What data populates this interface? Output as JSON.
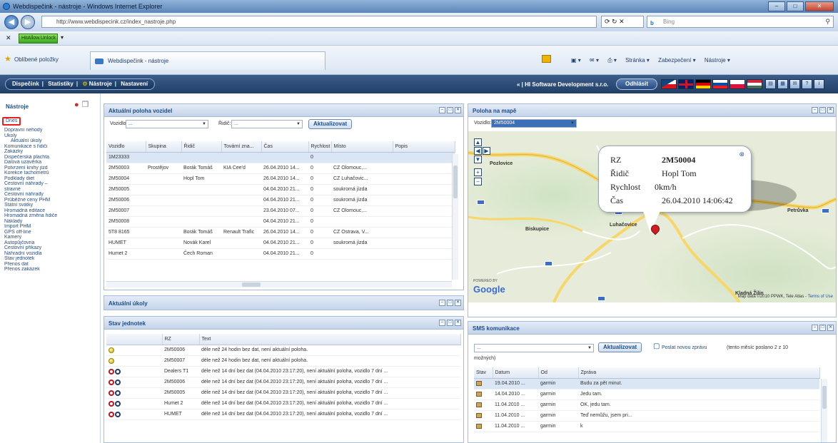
{
  "browser": {
    "title": "Webdispečink - nástroje - Windows Internet Explorer",
    "url": "http://www.webdispecink.cz/index_nastroje.php",
    "search_placeholder": "Bing",
    "toolbar_addon": "HitAllow.Unlock",
    "favorites_label": "Oblíbené položky",
    "tab_title": "Webdispečink - nástroje",
    "cmd": {
      "page": "Stránka ▾",
      "security": "Zabezpečení ▾",
      "tools": "Nástroje ▾"
    }
  },
  "header": {
    "nav": [
      "Dispečink",
      "Statistiky",
      "Nástroje",
      "Nastavení"
    ],
    "company": "« | HI Software Development s.r.o.",
    "logout": "Odhlásit"
  },
  "sidebar": {
    "title": "Nástroje",
    "items": [
      {
        "label": "Dnes",
        "highlight": true
      },
      {
        "label": "Dopravní nehody"
      },
      {
        "label": "Úkoly"
      },
      {
        "label": "Aktuální úkoly",
        "sub": true
      },
      {
        "label": "Komunikace s řidiči"
      },
      {
        "label": "Zakázky"
      },
      {
        "label": "Dispečerská plachta"
      },
      {
        "label": "Dalová uzávěrka"
      },
      {
        "label": "Potvrzení knihy jízd"
      },
      {
        "label": "Korekce tachometrů"
      },
      {
        "label": "Podklady diet"
      },
      {
        "label": "Cestovní náhrady –"
      },
      {
        "label": "stravné"
      },
      {
        "label": "Cestovní náhrady"
      },
      {
        "label": "Průběžné ceny PHM"
      },
      {
        "label": "Státní svátky"
      },
      {
        "label": "Hromadná editace"
      },
      {
        "label": "Hromadná změna řidiče"
      },
      {
        "label": "Náklady"
      },
      {
        "label": "Import PHM"
      },
      {
        "label": "GPS off-line"
      },
      {
        "label": "Kamery"
      },
      {
        "label": "Autopůjčovna"
      },
      {
        "label": "Cestovní příkazy"
      },
      {
        "label": "Náhradní vozidla"
      },
      {
        "label": "Stav jednotek"
      },
      {
        "label": "Přenos dat"
      },
      {
        "label": "Přenos zakázek"
      }
    ]
  },
  "positions_panel": {
    "title": "Aktuální poloha vozidel",
    "vehicle_label": "Vozidlo:",
    "vehicle_value": "...",
    "driver_label": "Řidič:",
    "driver_value": "...",
    "refresh": "Aktualizovat",
    "columns": [
      "Vozidlo",
      "Skupina",
      "Řidič",
      "Tovární zna...",
      "Čas",
      "Rychlost",
      "Místo",
      "Popis"
    ],
    "rows": [
      [
        "1M23333",
        "",
        "",
        "",
        "",
        "0",
        "",
        ""
      ],
      [
        "2M50003",
        "Prostějov",
        "Borák Tomáš",
        "KIA Cee'd",
        "26.04.2010 14...",
        "0",
        "CZ Olomouc,...",
        ""
      ],
      [
        "2M50004",
        "",
        "Hopl Tom",
        "",
        "26.04.2010 14...",
        "0",
        "CZ Luhačovic...",
        ""
      ],
      [
        "2M50005",
        "",
        "",
        "",
        "04.04.2010 21...",
        "0",
        "soukromá jízda",
        ""
      ],
      [
        "2M50006",
        "",
        "",
        "",
        "04.04.2010 21...",
        "0",
        "soukromá jízda",
        ""
      ],
      [
        "2M50007",
        "",
        "",
        "",
        "23.04.2010 07...",
        "0",
        "CZ Olomouc,...",
        ""
      ],
      [
        "2M50008",
        "",
        "",
        "",
        "04.04.2010 21...",
        "0",
        "",
        ""
      ],
      [
        "5T8 8165",
        "",
        "Borák Tomáš",
        "Renault Trafic",
        "26.04.2010 14...",
        "0",
        "CZ Ostrava, V...",
        ""
      ],
      [
        "HUMET",
        "",
        "Novák Karel",
        "",
        "04.04.2010 21...",
        "0",
        "soukromá jízda",
        ""
      ],
      [
        "Humet 2",
        "",
        "Čech Roman",
        "",
        "04.04.2010 21...",
        "0",
        "",
        ""
      ]
    ]
  },
  "tasks_panel": {
    "title": "Aktuální úkoly"
  },
  "units_panel": {
    "title": "Stav jednotek",
    "columns": [
      "",
      "RZ",
      "Text"
    ],
    "rows": [
      {
        "status": "yellow",
        "rz": "2M50006",
        "text": "déle než 24 hodin bez dat, není aktuální poloha."
      },
      {
        "status": "yellow",
        "rz": "2M50007",
        "text": "déle než 24 hodin bez dat, není aktuální poloha."
      },
      {
        "status": "oo",
        "rz": "Dealers T1",
        "text": "déle než 14 dní bez dat (04.04.2010 23:17:20), není aktuální poloha, vozidlo 7 dní ..."
      },
      {
        "status": "oo",
        "rz": "2M50006",
        "text": "déle než 14 dní bez dat (04.04.2010 23:17:20), není aktuální poloha, vozidlo 7 dní ..."
      },
      {
        "status": "oo",
        "rz": "2M50005",
        "text": "déle než 14 dní bez dat (04.04.2010 23:17:20), není aktuální poloha, vozidlo 7 dní ..."
      },
      {
        "status": "oo",
        "rz": "Humet 2",
        "text": "déle než 14 dní bez dat (04.04.2010 23:17:20), není aktuální poloha, vozidlo 7 dní ..."
      },
      {
        "status": "oo",
        "rz": "HUMET",
        "text": "déle než 14 dní bez dat (04.04.2010 23:17:20), není aktuální poloha, vozidlo 7 dní ..."
      }
    ]
  },
  "map_panel": {
    "title": "Poloha na mapě",
    "vehicle_label": "Vozidlo:",
    "vehicle_value": "2M50004",
    "popup": {
      "rz_label": "RZ",
      "rz_value": "2M50004",
      "driver_label": "Řidič",
      "driver_value": "Hopl Tom",
      "speed_label": "Rychlost",
      "speed_value": "0km/h",
      "time_label": "Čas",
      "time_value": "26.04.2010 14:06:42"
    },
    "places": [
      "Luhačovice",
      "Pozlovice",
      "Petrůvka",
      "Kladná Žilín",
      "Biskupice"
    ],
    "powered_by": "POWERED BY",
    "google": "Google",
    "credit": "Map data ©2010 PPWK, Tele Atlas - ",
    "terms": "Terms of Use"
  },
  "sms_panel": {
    "title": "SMS komunikace",
    "select_value": "...",
    "refresh": "Aktualizovat",
    "new_msg": "Poslat novou zprávu",
    "info": "(tento měsíc poslano 2 z 10",
    "info2": "možných)",
    "columns": [
      "Stav",
      "Datum",
      "Od",
      "Zpráva"
    ],
    "rows": [
      [
        "19.04.2010 ...",
        "garmin",
        "Budu za pět minut."
      ],
      [
        "14.04.2010 ...",
        "garmin",
        "Jedu tam."
      ],
      [
        "11.04.2010 ...",
        "garmin",
        "OK, jedu tam."
      ],
      [
        "11.04.2010 ...",
        "garmin",
        "Teď nemůžu, jsem pri..."
      ],
      [
        "11.04.2010 ...",
        "garmin",
        "k"
      ]
    ]
  }
}
